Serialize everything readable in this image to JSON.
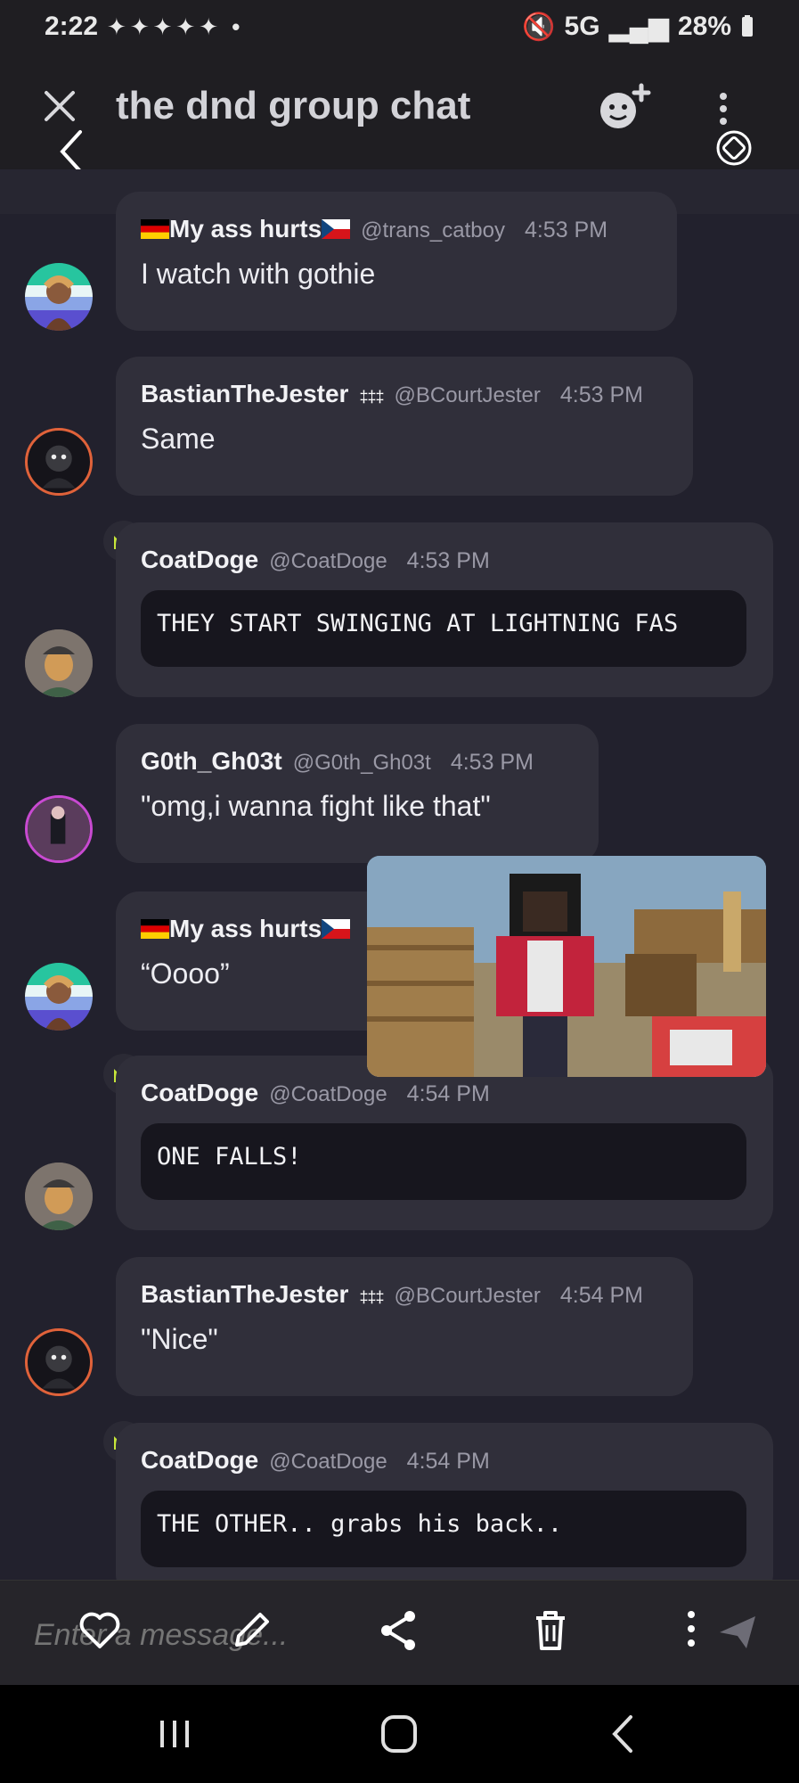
{
  "status": {
    "time": "2:22",
    "battery": "28%",
    "network": "5G"
  },
  "header": {
    "title": "the dnd group chat"
  },
  "messages": [
    {
      "display_name": "My ass hurts",
      "handle": "@trans_catboy",
      "time": "4:53 PM",
      "text": "I watch with gothie"
    },
    {
      "display_name": "BastianTheJester",
      "handle": "@BCourtJester",
      "time": "4:53 PM",
      "text": "Same"
    },
    {
      "display_name": "CoatDoge",
      "handle": "@CoatDoge",
      "time": "4:53 PM",
      "code": "THEY START SWINGING AT LIGHTNING FAS"
    },
    {
      "display_name": "G0th_Gh03t",
      "handle": "@G0th_Gh03t",
      "time": "4:53 PM",
      "text": "\"omg,i wanna fight like that\""
    },
    {
      "display_name": "My ass hurts",
      "text": "“Oooo”"
    },
    {
      "display_name": "CoatDoge",
      "handle": "@CoatDoge",
      "time": "4:54 PM",
      "code": "ONE FALLS!"
    },
    {
      "display_name": "BastianTheJester",
      "handle": "@BCourtJester",
      "time": "4:54 PM",
      "text": "\"Nice\""
    },
    {
      "display_name": "CoatDoge",
      "handle": "@CoatDoge",
      "time": "4:54 PM",
      "code": "THE OTHER.. grabs his back.."
    }
  ],
  "composer": {
    "placeholder": "Enter a message..."
  },
  "colors": {
    "background": "#22212d",
    "bubble": "#302f3a",
    "code_bg": "#17161e",
    "crown": "#c6e53a"
  },
  "icons": [
    "close-icon",
    "back-icon",
    "add-emoji-icon",
    "more-icon",
    "rotate-icon",
    "crown-icon",
    "heart-icon",
    "edit-icon",
    "share-icon",
    "trash-icon",
    "send-icon",
    "recents-icon",
    "home-icon",
    "nav-back-icon"
  ]
}
